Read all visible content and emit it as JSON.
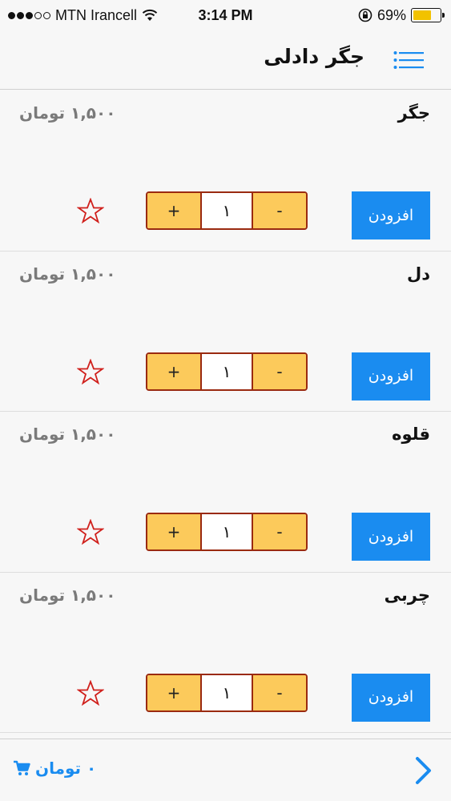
{
  "status_bar": {
    "carrier": "MTN Irancell",
    "time": "3:14 PM",
    "battery": "69%",
    "battery_level": 0.69,
    "signal_bars_filled": 3,
    "signal_bars_total": 5,
    "icons": [
      "wifi-icon",
      "orientation-lock-icon",
      "battery-icon"
    ]
  },
  "nav": {
    "title": "جگر دادلی",
    "menu_icon": "hamburger-menu-icon"
  },
  "items": [
    {
      "name": "جگر",
      "price": "۱,۵۰۰ تومان",
      "quantity": "۱",
      "add_label": "افزودن",
      "minus": "-",
      "plus": "+"
    },
    {
      "name": "دل",
      "price": "۱,۵۰۰ تومان",
      "quantity": "۱",
      "add_label": "افزودن",
      "minus": "-",
      "plus": "+"
    },
    {
      "name": "قلوه",
      "price": "۱,۵۰۰ تومان",
      "quantity": "۱",
      "add_label": "افزودن",
      "minus": "-",
      "plus": "+"
    },
    {
      "name": "چربی",
      "price": "۱,۵۰۰ تومان",
      "quantity": "۱",
      "add_label": "افزودن",
      "minus": "-",
      "plus": "+"
    }
  ],
  "footer": {
    "cart_total": "۰ تومان",
    "cart_icon": "shopping-cart-icon",
    "next_icon": "chevron-right-icon"
  },
  "colors": {
    "accent": "#1a8cf0",
    "stepper_fill": "#fcca5b",
    "stepper_border": "#9a2a10",
    "star": "#d0201c",
    "price": "#7a7a7a"
  }
}
